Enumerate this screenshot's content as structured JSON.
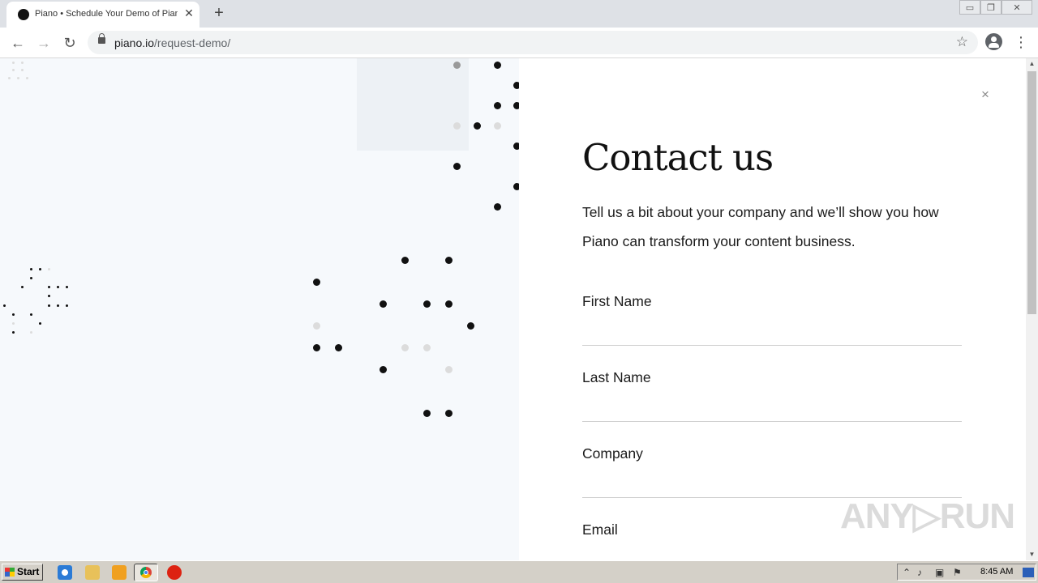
{
  "browser": {
    "tab_title": "Piano • Schedule Your Demo of Piano",
    "tab_close": "✕",
    "new_tab": "+",
    "url_host": "piano.io",
    "url_path": "/request-demo/",
    "back_icon": "←",
    "forward_icon": "→",
    "reload_icon": "↻",
    "star_icon": "☆",
    "menu_icon": "⋮",
    "window_minimize": "▭",
    "window_restore": "❐",
    "window_close": "✕"
  },
  "page": {
    "close_icon": "×",
    "heading": "Contact us",
    "intro": "Tell us a bit about your company and we’ll show you how Piano can transform your content business.",
    "fields": [
      {
        "label": "First Name",
        "value": ""
      },
      {
        "label": "Last Name",
        "value": ""
      },
      {
        "label": "Company",
        "value": ""
      },
      {
        "label": "Email",
        "value": ""
      }
    ]
  },
  "watermark": "ANY▷RUN",
  "taskbar": {
    "start_label": "Start",
    "clock": "8:45 AM"
  }
}
